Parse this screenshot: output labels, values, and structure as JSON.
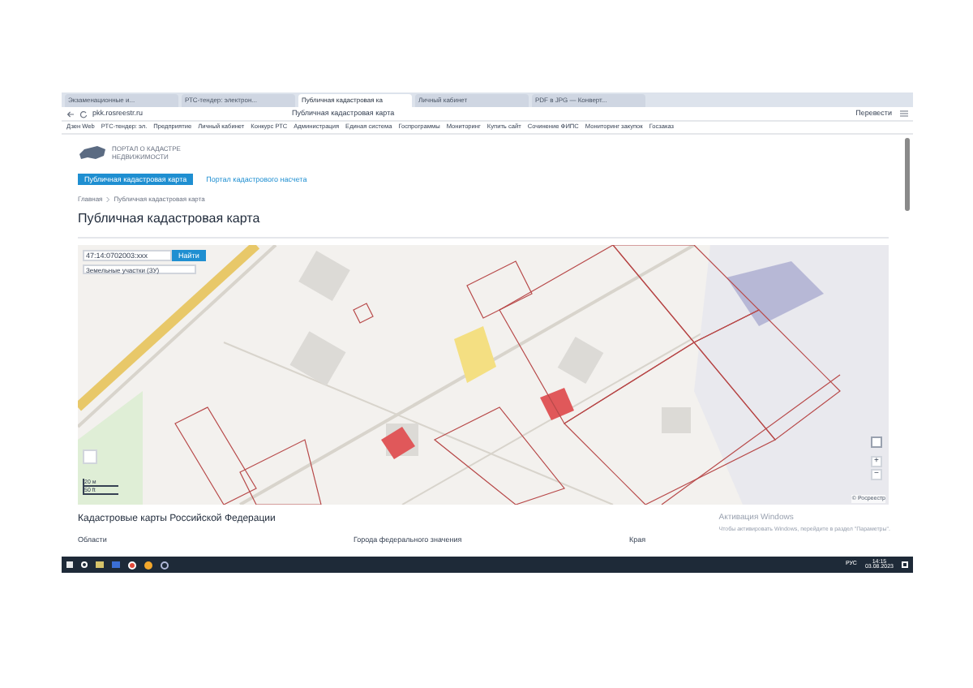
{
  "browser": {
    "tabs": [
      {
        "title": "Экзаменационные и...",
        "selected": false
      },
      {
        "title": "РТС-тендер: электрон...",
        "selected": false
      },
      {
        "title": "Публичная кадастровая ка",
        "selected": true
      },
      {
        "title": "Личный кабинет",
        "selected": false
      },
      {
        "title": "PDF в JPG — Конверт...",
        "selected": false
      }
    ],
    "url": "pkk.rosreestr.ru",
    "page_title": "Публичная кадастровая карта",
    "translate": "Перевести",
    "bookmarks": [
      "Дзен Web",
      "РТС-тендер: эл.",
      "Предприятие",
      "Личный кабинет",
      "Конкурс РТС",
      "Администрация",
      "Единая система",
      "Госпрограммы",
      "Мониторинг",
      "Купить сайт",
      "Сочинение ФИПС",
      "Мониторинг закупок",
      "Госзаказ"
    ]
  },
  "site": {
    "logo_text": "ПОРТАЛ О КАДАСТРЕ НЕДВИЖИМОСТИ",
    "nav": [
      {
        "label": "Публичная кадастровая карта",
        "selected": true
      },
      {
        "label": "Портал кадастрового насчета",
        "selected": false
      }
    ],
    "breadcrumbs": [
      "Главная",
      "Публичная кадастровая карта"
    ],
    "heading": "Публичная кадастровая карта"
  },
  "map": {
    "search_value": "47:14:0702003:xxx",
    "search_button": "Найти",
    "layer_select": "Земельные участки (ЗУ)",
    "scale": [
      "20 м",
      "50 ft"
    ],
    "zoom_in": "+",
    "zoom_out": "−",
    "attribution": "© Росреестр"
  },
  "regions": {
    "heading": "Кадастровые карты Российской Федерации",
    "columns": [
      "Области",
      "Города федерального значения",
      "Края"
    ]
  },
  "activation": {
    "title": "Активация Windows",
    "text": "Чтобы активировать Windows, перейдите в раздел \"Параметры\"."
  },
  "taskbar": {
    "language": "РУС",
    "time": "14:15",
    "date": "03.08.2023"
  }
}
